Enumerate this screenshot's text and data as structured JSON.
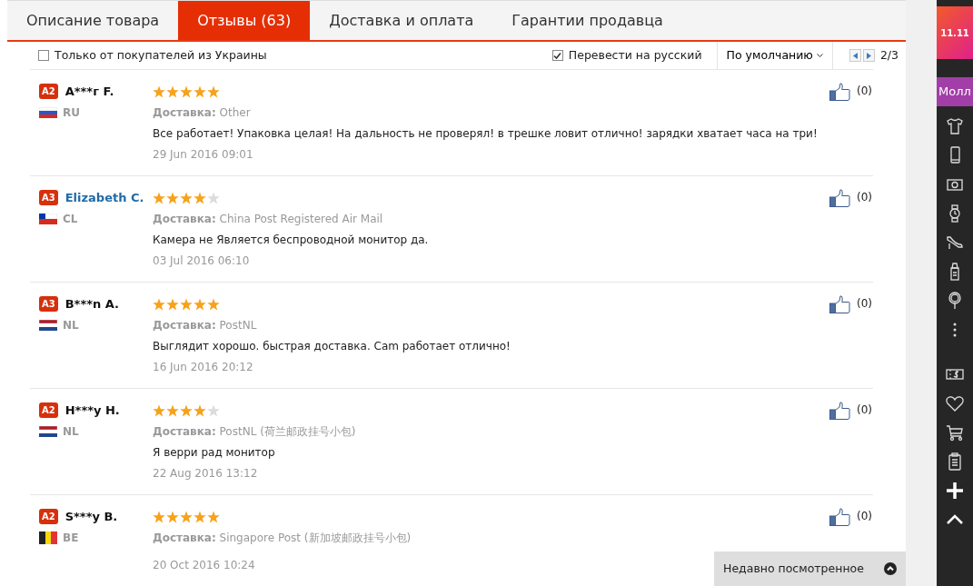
{
  "tabs": [
    {
      "label": "Описание товара",
      "selected": false
    },
    {
      "label": "Отзывы (63)",
      "selected": true
    },
    {
      "label": "Доставка и оплата",
      "selected": false
    },
    {
      "label": "Гарантии продавца",
      "selected": false
    }
  ],
  "filters": {
    "ukraine_only": {
      "label": "Только от покупателей из Украины",
      "checked": false
    },
    "translate": {
      "label": "Перевести на русский",
      "checked": true
    },
    "sort": {
      "value": "По умолчанию"
    },
    "pager": "2/3"
  },
  "reviews": [
    {
      "level": "A2",
      "name": "A***г F.",
      "name_link": false,
      "kind": "ru",
      "country": "RU",
      "stars": 5,
      "delivery_label": "Доставка:",
      "delivery": "Other",
      "text": "Все работает! Упаковка целая! На дальность не проверял! в трешке ловит отлично! зарядки хватает часа на три!",
      "date": "29 Jun 2016 09:01",
      "likes": "(0)"
    },
    {
      "level": "A3",
      "name": "Elizabeth C.",
      "name_link": true,
      "kind": "cl",
      "country": "CL",
      "stars": 4,
      "delivery_label": "Доставка:",
      "delivery": "China Post Registered Air Mail",
      "text": "Камера не Является беспроводной монитор да.",
      "date": "03 Jul 2016 06:10",
      "likes": "(0)"
    },
    {
      "level": "A3",
      "name": "B***n A.",
      "name_link": false,
      "kind": "nl",
      "country": "NL",
      "stars": 5,
      "delivery_label": "Доставка:",
      "delivery": "PostNL",
      "text": "Выглядит хорошо. быстрая доставка. Cam работает отлично!",
      "date": "16 Jun 2016 20:12",
      "likes": "(0)"
    },
    {
      "level": "A2",
      "name": "H***y H.",
      "name_link": false,
      "kind": "nl",
      "country": "NL",
      "stars": 4,
      "delivery_label": "Доставка:",
      "delivery": "PostNL (荷兰邮政挂号小包)",
      "text": "Я верри рад монитор",
      "date": "22 Aug 2016 13:12",
      "likes": "(0)"
    },
    {
      "level": "A2",
      "name": "S***y B.",
      "name_link": false,
      "kind": "be",
      "country": "BE",
      "stars": 5,
      "delivery_label": "Доставка:",
      "delivery": "Singapore Post (新加坡邮政挂号小包)",
      "date": "20 Oct 2016 10:24",
      "likes": "(0)"
    }
  ],
  "recently_viewed": {
    "label": "Недавно посмотренное"
  },
  "sidebar": {
    "logo": "11.11",
    "mall": "Молл"
  }
}
